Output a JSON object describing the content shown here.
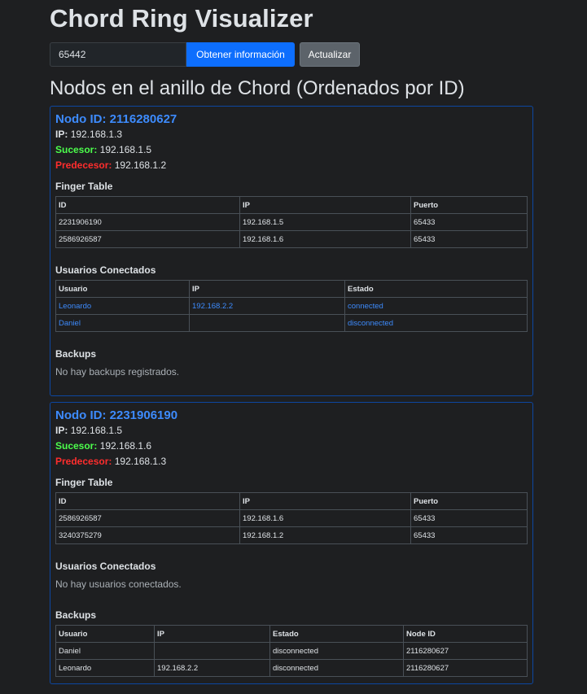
{
  "title": "Chord Ring Visualizer",
  "controls": {
    "port_value": "65442",
    "get_info_label": "Obtener información",
    "refresh_label": "Actualizar"
  },
  "nodes_heading": "Nodos en el anillo de Chord (Ordenados por ID)",
  "labels": {
    "node_id": "Nodo ID:",
    "ip": "IP:",
    "successor": "Sucesor:",
    "predecessor": "Predecesor:",
    "finger_table": "Finger Table",
    "users": "Usuarios Conectados",
    "backups": "Backups",
    "no_backups": "No hay backups registrados.",
    "no_users": "No hay usuarios conectados."
  },
  "finger_headers": [
    "ID",
    "IP",
    "Puerto"
  ],
  "users_headers": [
    "Usuario",
    "IP",
    "Estado"
  ],
  "backups_headers": [
    "Usuario",
    "IP",
    "Estado",
    "Node ID"
  ],
  "nodes": [
    {
      "id": "2116280627",
      "ip": "192.168.1.3",
      "successor": "192.168.1.5",
      "predecessor": "192.168.1.2",
      "finger_table": [
        [
          "2231906190",
          "192.168.1.5",
          "65433"
        ],
        [
          "2586926587",
          "192.168.1.6",
          "65433"
        ]
      ],
      "users": [
        [
          "Leonardo",
          "192.168.2.2",
          "connected"
        ],
        [
          "Daniel",
          "",
          "disconnected"
        ]
      ],
      "backups": []
    },
    {
      "id": "2231906190",
      "ip": "192.168.1.5",
      "successor": "192.168.1.6",
      "predecessor": "192.168.1.3",
      "finger_table": [
        [
          "2586926587",
          "192.168.1.6",
          "65433"
        ],
        [
          "3240375279",
          "192.168.1.2",
          "65433"
        ]
      ],
      "users": [],
      "backups": [
        [
          "Daniel",
          "",
          "disconnected",
          "2116280627"
        ],
        [
          "Leonardo",
          "192.168.2.2",
          "disconnected",
          "2116280627"
        ]
      ]
    }
  ]
}
